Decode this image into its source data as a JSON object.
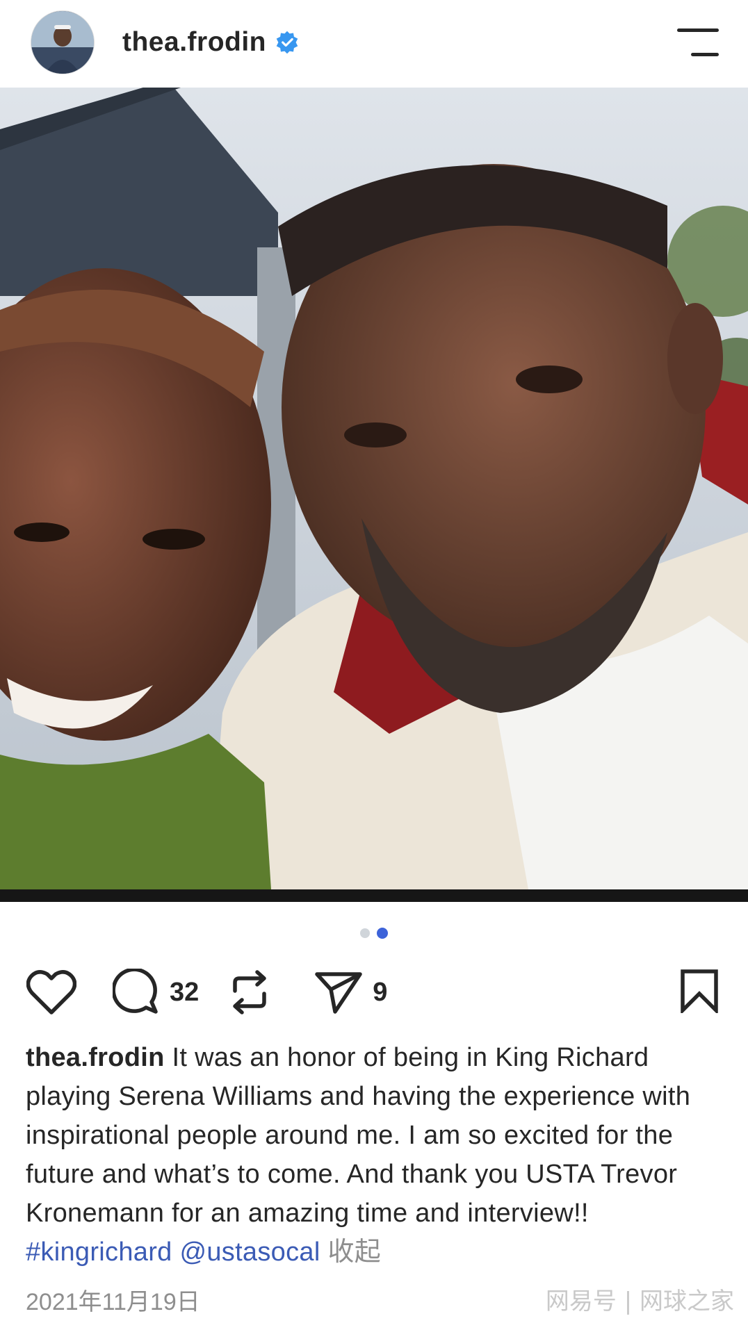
{
  "header": {
    "username": "thea.frodin",
    "verified": true,
    "avatar_icon": "profile-photo",
    "menu_icon": "menu-lines-icon"
  },
  "photo": {
    "description_icon": "post-photo",
    "carousel_total": 2,
    "carousel_active": 2
  },
  "actions": {
    "like_icon": "heart-icon",
    "comment_icon": "comment-icon",
    "comment_count": "32",
    "repost_icon": "repost-icon",
    "share_icon": "send-icon",
    "share_count": "9",
    "bookmark_icon": "bookmark-icon"
  },
  "caption": {
    "username": "thea.frodin",
    "text": "It was an honor of being in King Richard playing Serena Williams and having the experience with inspirational people around me. I am so excited for the future and what’s to come. And thank you USTA Trevor Kronemann for an amazing time and interview!!",
    "hashtag": "#kingrichard",
    "mention": "@ustasocal",
    "collapse_label": "收起"
  },
  "date": "2021年11月19日",
  "watermark": "网易号 | 网球之家",
  "colors": {
    "text": "#262626",
    "link": "#3b5bb5",
    "muted": "#8e8e8e",
    "verified": "#3897f0",
    "dot_active": "#3d63d9"
  }
}
